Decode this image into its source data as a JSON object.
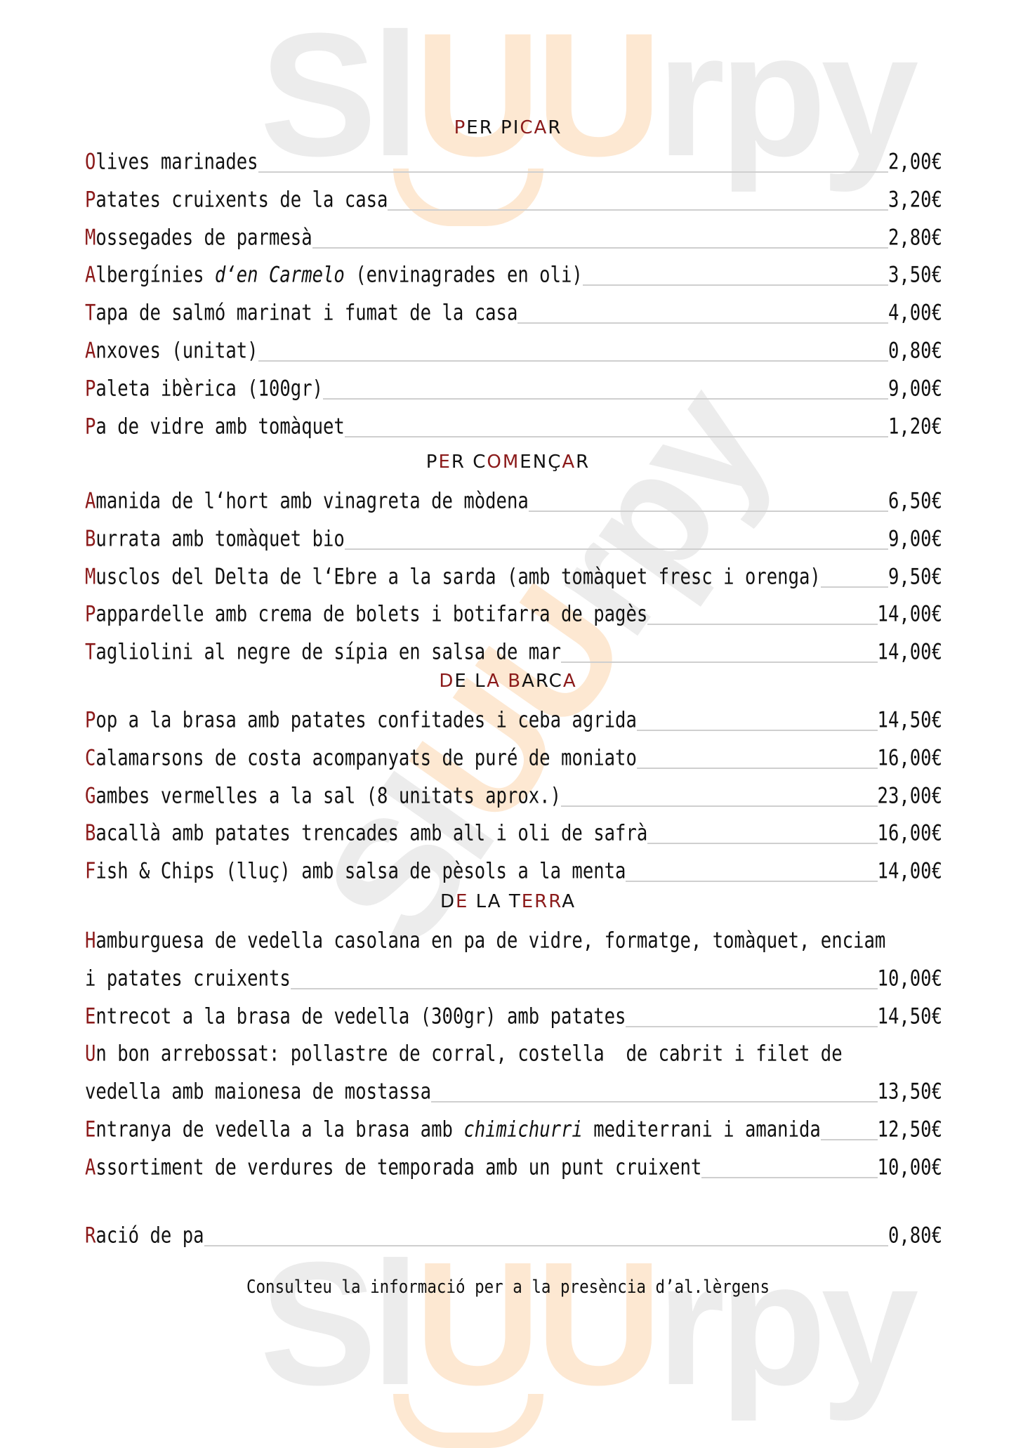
{
  "watermark": {
    "brand_gray_1": "Sl",
    "brand_orange": "UU",
    "brand_gray_2": "rpy"
  },
  "colors": {
    "accent_red": "#8b1a1a",
    "text": "#111111",
    "leader": "#cfcfcf",
    "watermark_gray": "#ececec",
    "watermark_orange": "#fde8d2"
  },
  "sections": [
    {
      "title": "PER PICAR",
      "title_letters": [
        [
          "P",
          1
        ],
        [
          "E",
          0
        ],
        [
          "R",
          0
        ],
        [
          " ",
          0
        ],
        [
          "P",
          0
        ],
        [
          "I",
          0
        ],
        [
          "C",
          1
        ],
        [
          "A",
          1
        ],
        [
          "R",
          0
        ]
      ],
      "items": [
        {
          "first": "O",
          "rest": "lives marinades",
          "price": "2,00€"
        },
        {
          "first": "P",
          "rest": "atates cruixents de la casa",
          "price": "3,20€"
        },
        {
          "first": "M",
          "rest": "ossegades de parmesà",
          "price": "2,80€"
        },
        {
          "first": "A",
          "rest": "lbergínies ",
          "italic": "d‘en Carmelo",
          "after": " (envinagrades en oli)",
          "price": "3,50€"
        },
        {
          "first": "T",
          "rest": "apa de salmó marinat i fumat de la casa",
          "price": "4,00€"
        },
        {
          "first": "A",
          "rest": "nxoves (unitat)",
          "price": "0,80€"
        },
        {
          "first": "P",
          "rest": "aleta ibèrica (100gr)",
          "price": "9,00€"
        },
        {
          "first": "P",
          "rest": "a de vidre amb tomàquet",
          "price": "1,20€"
        }
      ]
    },
    {
      "title": "PER COMENÇAR",
      "title_letters": [
        [
          "P",
          0
        ],
        [
          "E",
          1
        ],
        [
          "R",
          0
        ],
        [
          " ",
          0
        ],
        [
          "C",
          0
        ],
        [
          "O",
          1
        ],
        [
          "M",
          1
        ],
        [
          "E",
          0
        ],
        [
          "N",
          0
        ],
        [
          "Ç",
          0
        ],
        [
          "A",
          1
        ],
        [
          "R",
          0
        ]
      ],
      "items": [
        {
          "first": "A",
          "rest": "manida de l‘hort amb vinagreta de mòdena",
          "price": "6,50€"
        },
        {
          "first": "B",
          "rest": "urrata amb tomàquet bio",
          "price": "9,00€"
        },
        {
          "first": "M",
          "rest": "usclos del Delta de l‘Ebre a la sarda (amb tomàquet fresc i orenga)",
          "price": "9,50€"
        },
        {
          "first": "P",
          "rest": "appardelle amb crema de bolets i botifarra de pagès",
          "price": "14,00€"
        },
        {
          "first": "T",
          "rest": "agliolini al negre de sípia en salsa de mar",
          "price": "14,00€"
        }
      ]
    },
    {
      "title": "DE LA BARCA",
      "title_letters": [
        [
          "D",
          1
        ],
        [
          "E",
          0
        ],
        [
          " ",
          0
        ],
        [
          "L",
          0
        ],
        [
          "A",
          1
        ],
        [
          " ",
          0
        ],
        [
          "B",
          1
        ],
        [
          "A",
          0
        ],
        [
          "R",
          0
        ],
        [
          "C",
          0
        ],
        [
          "A",
          1
        ]
      ],
      "items": [
        {
          "first": "P",
          "rest": "op a la brasa amb patates confitades i ceba agrida",
          "price": "14,50€"
        },
        {
          "first": "C",
          "rest": "alamarsons de costa acompanyats de puré de moniato",
          "price": "16,00€"
        },
        {
          "first": "G",
          "rest": "ambes vermelles a la sal (8 unitats aprox.)",
          "price": "23,00€"
        },
        {
          "first": "B",
          "rest": "acallà amb patates trencades amb all i oli de safrà",
          "price": "16,00€"
        },
        {
          "first": "F",
          "rest": "ish & Chips (lluç) amb salsa de pèsols a la menta",
          "price": "14,00€"
        }
      ]
    },
    {
      "title": "DE LA TERRA",
      "title_letters": [
        [
          "D",
          0
        ],
        [
          "E",
          1
        ],
        [
          " ",
          0
        ],
        [
          "L",
          0
        ],
        [
          "A",
          0
        ],
        [
          " ",
          0
        ],
        [
          "T",
          0
        ],
        [
          "E",
          1
        ],
        [
          "R",
          1
        ],
        [
          "R",
          1
        ],
        [
          "A",
          0
        ]
      ],
      "items": [
        {
          "first": "H",
          "rest": "amburguesa de vedella casolana en pa de vidre, formatge, tomàquet, enciam",
          "price": "",
          "continuation": "i patates cruixents",
          "continuation_price": "10,00€"
        },
        {
          "first": "E",
          "rest": "ntrecot a la brasa de vedella (300gr) amb patates",
          "price": "14,50€"
        },
        {
          "first": "U",
          "rest": "n bon arrebossat: pollastre de corral, costella  de cabrit i filet de",
          "price": "",
          "continuation": "vedella amb maionesa de mostassa",
          "continuation_price": "13,50€"
        },
        {
          "first": "E",
          "rest": "ntranya de vedella a la brasa amb ",
          "italic": "chimichurri",
          "after": " mediterrani i amanida",
          "price": "12,50€"
        },
        {
          "first": "A",
          "rest": "ssortiment de verdures de temporada amb un punt cruixent",
          "price": "10,00€"
        }
      ]
    }
  ],
  "bread": {
    "first": "R",
    "rest": "ació de pa",
    "price": "0,80€"
  },
  "footer": "Consulteu la informació per a la presència d’al.lèrgens"
}
